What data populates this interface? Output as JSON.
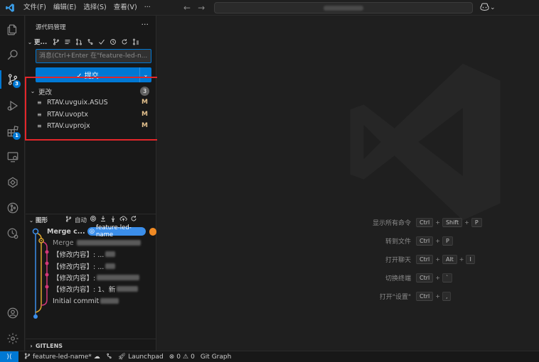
{
  "titlebar": {
    "menu": [
      "文件(F)",
      "编辑(E)",
      "选择(S)",
      "查看(V)",
      "···"
    ],
    "back": "←",
    "forward": "→",
    "search_value": ""
  },
  "activity": {
    "items": [
      {
        "name": "explorer",
        "badge": ""
      },
      {
        "name": "search",
        "badge": ""
      },
      {
        "name": "source-control",
        "badge": "3"
      },
      {
        "name": "run-debug",
        "badge": ""
      },
      {
        "name": "extensions",
        "badge": "1"
      },
      {
        "name": "remote-explorer",
        "badge": ""
      },
      {
        "name": "gitlens",
        "badge": ""
      },
      {
        "name": "git-graph",
        "badge": ""
      },
      {
        "name": "timeline",
        "badge": ""
      }
    ],
    "account": "account",
    "settings": "settings"
  },
  "sidebar": {
    "title": "源代码管理",
    "more": "···",
    "repo_label": "更...",
    "commit_placeholder": "消息(Ctrl+Enter 在\"feature-led-n...",
    "commit_button": "✓ 提交",
    "changes": {
      "title": "更改",
      "count": "3",
      "files": [
        {
          "name": "RTAV.uvguix.ASUS",
          "status": "M"
        },
        {
          "name": "RTAV.uvoptx",
          "status": "M"
        },
        {
          "name": "RTAV.uvprojx",
          "status": "M"
        }
      ]
    },
    "graph": {
      "title": "图形",
      "auto_label": "自动",
      "branch": "feature-led-name",
      "commits": [
        {
          "msg": "Merge c..."
        },
        {
          "msg": "Merge"
        },
        {
          "msg": "【修改内容】: ..."
        },
        {
          "msg": "【修改内容】: ..."
        },
        {
          "msg": "【修改内容】: "
        },
        {
          "msg": "【修改内容】: 1、新"
        },
        {
          "msg": "Initial commit"
        }
      ]
    },
    "gitlens": "GITLENS"
  },
  "editor": {
    "shortcuts": [
      {
        "label": "显示所有命令",
        "keys": [
          "Ctrl",
          "Shift",
          "P"
        ]
      },
      {
        "label": "转到文件",
        "keys": [
          "Ctrl",
          "P"
        ]
      },
      {
        "label": "打开聊天",
        "keys": [
          "Ctrl",
          "Alt",
          "I"
        ]
      },
      {
        "label": "切换终端",
        "keys": [
          "Ctrl",
          "`"
        ]
      },
      {
        "label": "打开\"设置\"",
        "keys": [
          "Ctrl",
          ","
        ]
      }
    ]
  },
  "statusbar": {
    "branch": "feature-led-name*",
    "launchpad": "Launchpad",
    "errors": "0",
    "warnings": "0",
    "git_graph": "Git Graph"
  },
  "colors": {
    "accent": "#0078d4",
    "highlight": "#e3262a",
    "modified": "#e2c08d",
    "branch_pill": "#3b8eea"
  }
}
